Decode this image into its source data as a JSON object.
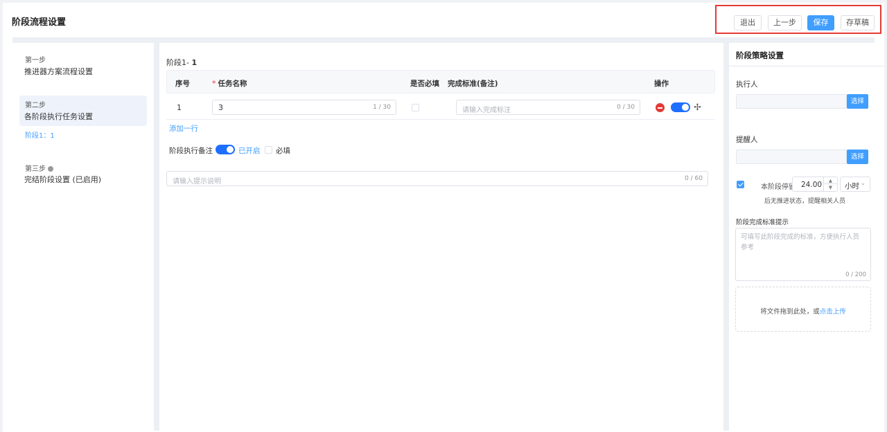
{
  "header": {
    "title": "阶段流程设置",
    "buttons": {
      "exit": "退出",
      "prev": "上一步",
      "save": "保存",
      "draft": "存草稿"
    }
  },
  "steps": [
    {
      "title": "第一步",
      "name": "推进器方案流程设置"
    },
    {
      "title": "第二步",
      "name": "各阶段执行任务设置",
      "sub": "阶段1：1",
      "active": true
    },
    {
      "title": "第三步",
      "name": "完结阶段设置 (已启用)"
    }
  ],
  "main": {
    "stage_prefix": "阶段1-",
    "stage_num": "1",
    "table": {
      "headers": {
        "index": "序号",
        "task_name": "任务名称",
        "required": "是否必填",
        "standard": "完成标准(备注)",
        "action": "操作"
      },
      "required_mark": "*",
      "rows": [
        {
          "index": "1",
          "task_name": "3",
          "task_count": "1 / 30",
          "required": false,
          "standard_placeholder": "请输入完成标注",
          "standard_count": "0 / 30",
          "enabled": true
        }
      ]
    },
    "add_row": "添加一行",
    "remark": {
      "label": "阶段执行备注",
      "enabled": true,
      "status": "已开启",
      "required_label": "必填",
      "required": false
    },
    "hint": {
      "placeholder": "请输入提示说明",
      "count": "0 / 60"
    }
  },
  "right": {
    "title": "阶段策略设置",
    "executor": {
      "label": "执行人",
      "button": "选择"
    },
    "reminder": {
      "label": "提醒人",
      "button": "选择"
    },
    "stay": {
      "checked": true,
      "label": "本阶段停留",
      "value": "24.00",
      "unit": "小时",
      "note": "后无推进状态，提醒相关人员"
    },
    "standard_tip": {
      "label": "阶段完成标准提示",
      "placeholder": "可填写此阶段完成的标准，方便执行人员参考",
      "count": "0 / 200"
    },
    "upload": {
      "text": "将文件拖到此处，或",
      "link": "点击上传"
    }
  },
  "colors": {
    "primary": "#409eff",
    "switch": "#1e6fff",
    "danger": "#e53935",
    "highlight_border": "#e53935"
  }
}
